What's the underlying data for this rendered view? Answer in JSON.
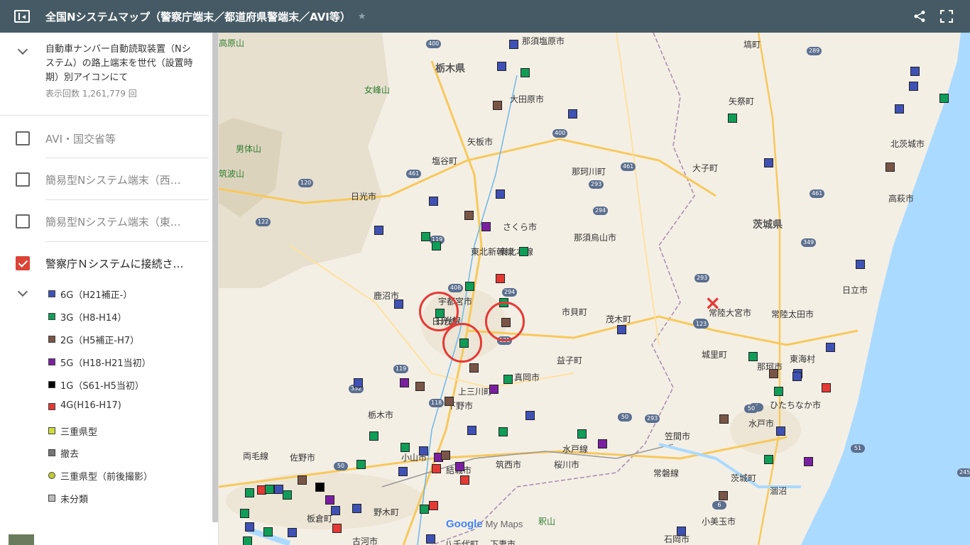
{
  "header": {
    "title": "全国Nシステムマップ（警察庁端末／都道府県警端末／AVI等）",
    "star_glyph": "★"
  },
  "sidebar": {
    "description": "自動車ナンバー自動読取装置（Nシステム）の路上端末を世代（設置時期）別アイコンにて",
    "view_count": "表示回数 1,261,779 回",
    "layers": [
      {
        "label": "AVI・国交省等",
        "checked": false
      },
      {
        "label": "簡易型Nシステム端末（西…",
        "checked": false
      },
      {
        "label": "簡易型Nシステム端末（東…",
        "checked": false
      },
      {
        "label": "警察庁Ｎシステムに接続さ…",
        "checked": true
      }
    ],
    "legend": [
      {
        "label": "6G（H21補正-）",
        "color": "#3f51b5",
        "shape": "square"
      },
      {
        "label": "3G（H8-H14）",
        "color": "#0f9d58",
        "shape": "square"
      },
      {
        "label": "2G（H5補正-H7）",
        "color": "#795548",
        "shape": "square"
      },
      {
        "label": "5G（H18-H21当初）",
        "color": "#7b1fa2",
        "shape": "square"
      },
      {
        "label": "1G（S61-H5当初）",
        "color": "#000000",
        "shape": "square"
      },
      {
        "label": "4G(H16-H17)",
        "color": "#e53935",
        "shape": "square"
      },
      {
        "label": "三重県型",
        "color": "#cddc39",
        "shape": "square"
      },
      {
        "label": "撤去",
        "color": "#757575",
        "shape": "square"
      },
      {
        "label": "三重県型（前後撮影）",
        "color": "#c0ca33",
        "shape": "circle"
      },
      {
        "label": "未分類",
        "color": "#bdbdbd",
        "shape": "square"
      }
    ]
  },
  "map": {
    "prefectures": [
      "栃木県",
      "茨城県"
    ],
    "places": [
      "那須塩原市",
      "大田原市",
      "矢板市",
      "塩谷町",
      "日光市",
      "さくら市",
      "那珂川町",
      "那須烏山市",
      "宇都宮市",
      "鹿沼市",
      "市貝町",
      "茂木町",
      "益子町",
      "真岡市",
      "上三川町",
      "下野市",
      "栃木市",
      "佐野市",
      "小山市",
      "結城市",
      "筑西市",
      "桜川市",
      "笠間市",
      "水戸市",
      "ひたちなか市",
      "那珂市",
      "常陸大宮市",
      "常陸太田市",
      "日立市",
      "高萩市",
      "北茨城市",
      "大子町",
      "矢祭町",
      "塙町",
      "城里町",
      "東海村",
      "茨城町",
      "小美玉市",
      "石岡市",
      "古河市",
      "野木町",
      "板倉町",
      "八千代町",
      "下妻市",
      "両毛線",
      "日光線",
      "東北本線",
      "水戸線",
      "常磐線",
      "東北新幹線",
      "日光線",
      "涸沼"
    ],
    "parks": [
      "高原山",
      "女峰山",
      "男体山",
      "筑波山",
      "釈山"
    ],
    "roads": [
      "400",
      "289",
      "400",
      "461",
      "461",
      "120",
      "122",
      "119",
      "293",
      "294",
      "408",
      "119",
      "352",
      "293",
      "123",
      "121",
      "294",
      "349",
      "461",
      "293",
      "123",
      "50",
      "118",
      "50",
      "6",
      "245",
      "51",
      "6",
      "50"
    ],
    "logo": "Google",
    "logo_suffix": "My Maps",
    "icons": [
      "share-icon",
      "fullscreen-icon",
      "sidebar-toggle-icon",
      "star-icon",
      "chevron-down-icon"
    ]
  }
}
